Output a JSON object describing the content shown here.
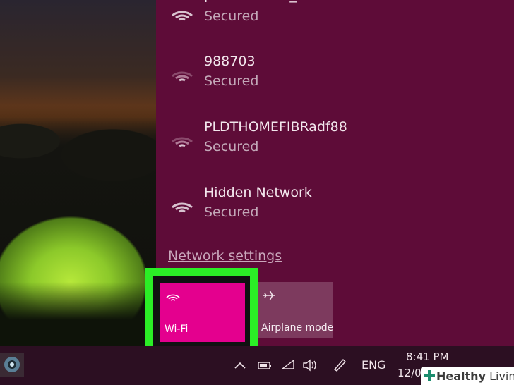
{
  "networks": [
    {
      "name": "platibertcam_bdsa",
      "status": "Secured"
    },
    {
      "name": "988703",
      "status": "Secured"
    },
    {
      "name": "PLDTHOMEFIBRadf88",
      "status": "Secured"
    },
    {
      "name": "Hidden Network",
      "status": "Secured"
    }
  ],
  "network_settings_label": "Network settings",
  "quick_actions": {
    "wifi_label": "Wi-Fi",
    "airplane_label": "Airplane mode"
  },
  "taskbar": {
    "language": "ENG",
    "time": "8:41 PM",
    "date": "12/0"
  },
  "watermark": {
    "bold": "Healthy",
    "light": " Living"
  },
  "colors": {
    "flyout_bg": "#5e0c38",
    "wifi_tile": "#e4008e",
    "highlight": "#2bee26"
  }
}
